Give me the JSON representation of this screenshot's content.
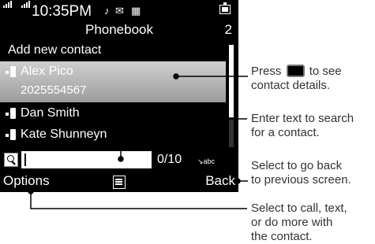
{
  "status": {
    "time": "10:35PM",
    "signal_1_label": "",
    "signal_2_label": "",
    "icons": [
      "music-note-icon",
      "message-icon",
      "voicemail-icon",
      "battery-icon"
    ]
  },
  "header": {
    "title": "Phonebook",
    "count": "2"
  },
  "list": {
    "add_new": "Add new contact",
    "contacts": [
      {
        "name": "Alex Pico",
        "number": "2025554567",
        "selected": true
      },
      {
        "name": "Dan Smith"
      },
      {
        "name": "Kate Shunneyn"
      }
    ]
  },
  "search": {
    "value": "",
    "char_count": "0/10",
    "input_mode": "abc"
  },
  "softkeys": {
    "left": "Options",
    "right": "Back"
  },
  "callouts": {
    "contact_details": {
      "line1_before": "Press",
      "line1_after": "to see",
      "line2": "contact details."
    },
    "search": {
      "line1": "Enter text to search",
      "line2": "for a contact."
    },
    "back": {
      "line1": "Select to go back",
      "line2": "to previous screen."
    },
    "options": {
      "line1": "Select to call, text,",
      "line2": "or do more with",
      "line3": "the contact."
    }
  },
  "colors": {
    "screen_bg": "#000000",
    "selected_row": "#b5b5b5",
    "callout_text": "#333333",
    "leader_line": "#000000"
  }
}
